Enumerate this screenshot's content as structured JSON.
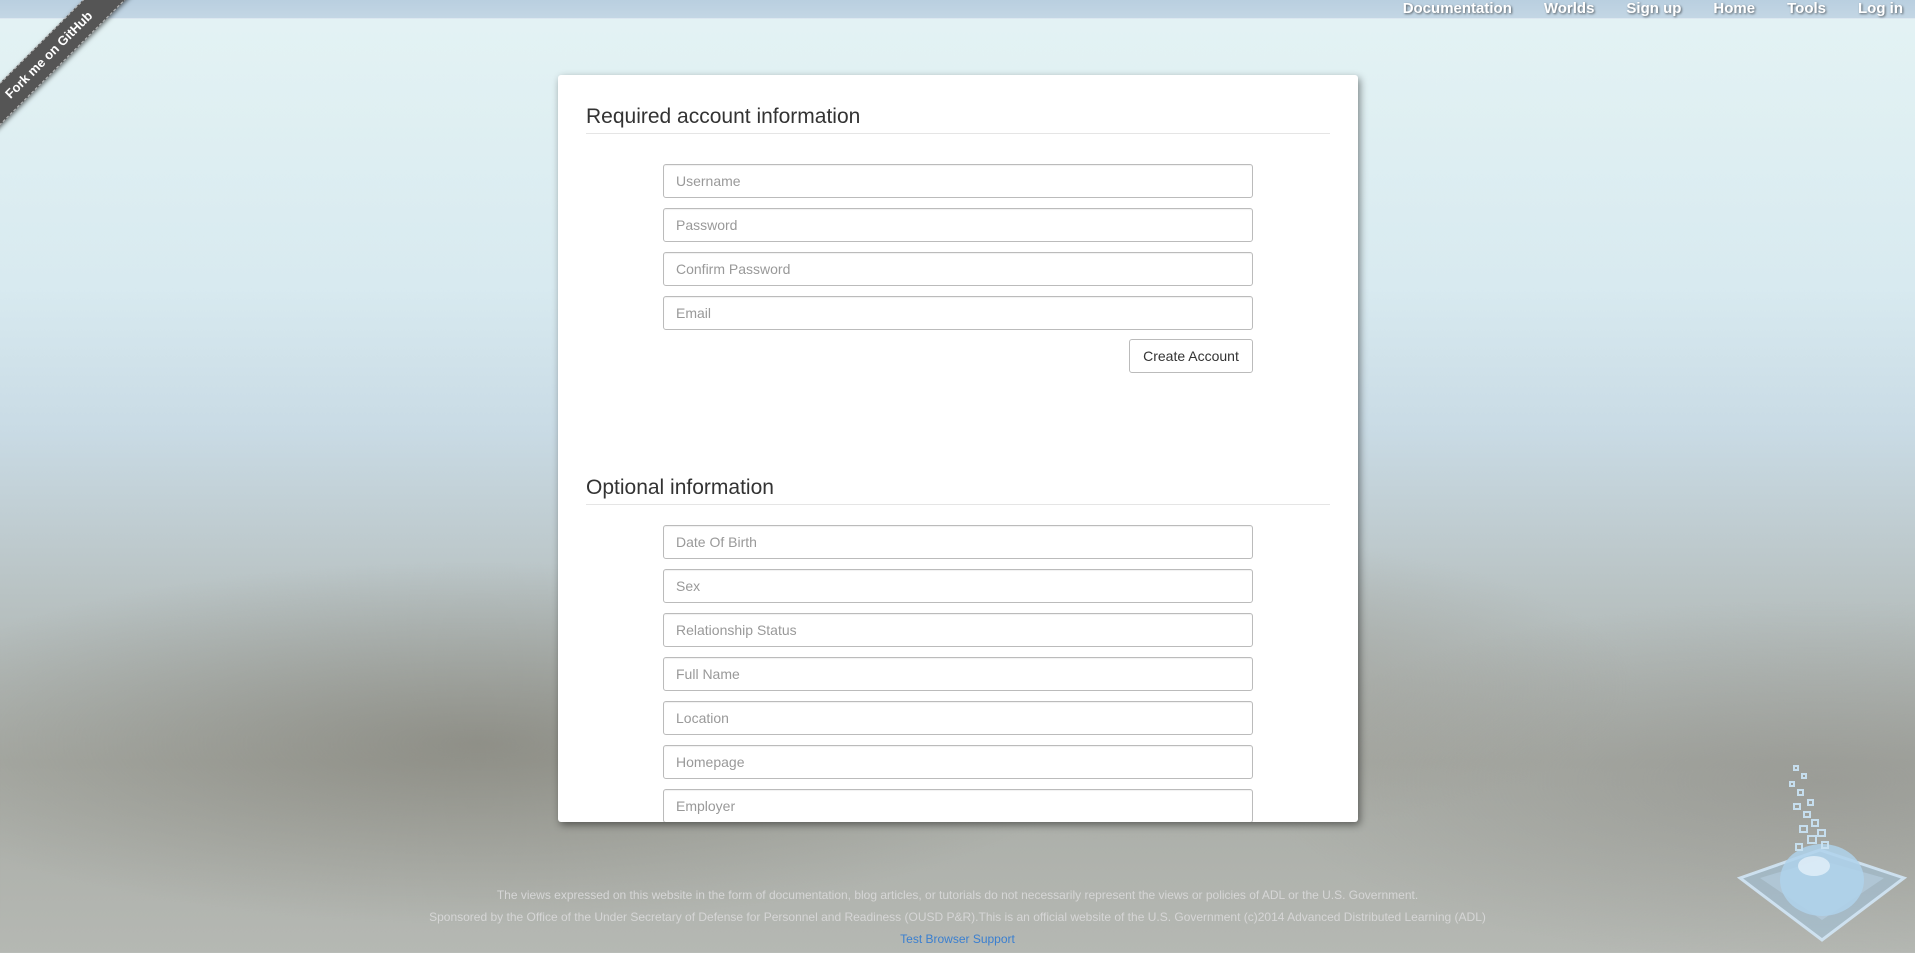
{
  "nav": {
    "items": [
      "Documentation",
      "Worlds",
      "Sign up",
      "Home",
      "Tools",
      "Log in"
    ]
  },
  "ribbon": {
    "label": "Fork me on GitHub"
  },
  "required": {
    "title": "Required account information",
    "fields": {
      "username": "Username",
      "password": "Password",
      "confirm_password": "Confirm Password",
      "email": "Email"
    },
    "submit_label": "Create Account"
  },
  "optional": {
    "title": "Optional information",
    "fields": {
      "dob": "Date Of Birth",
      "sex": "Sex",
      "relationship": "Relationship Status",
      "full_name": "Full Name",
      "location": "Location",
      "homepage": "Homepage",
      "employer": "Employer"
    }
  },
  "footer": {
    "disclaimer": "The views expressed on this website in the form of documentation, blog articles, or tutorials do not necessarily represent the views or policies of ADL or the U.S. Government.",
    "sponsor": "Sponsored by the Office of the Under Secretary of Defense for Personnel and Readiness (OUSD P&R).This is an official website of the U.S. Government (c)2014 Advanced Distributed Learning (ADL)",
    "link_label": "Test Browser Support"
  },
  "colors": {
    "link": "#3a7fd0",
    "ribbon": "#555555",
    "card": "#ffffff"
  }
}
